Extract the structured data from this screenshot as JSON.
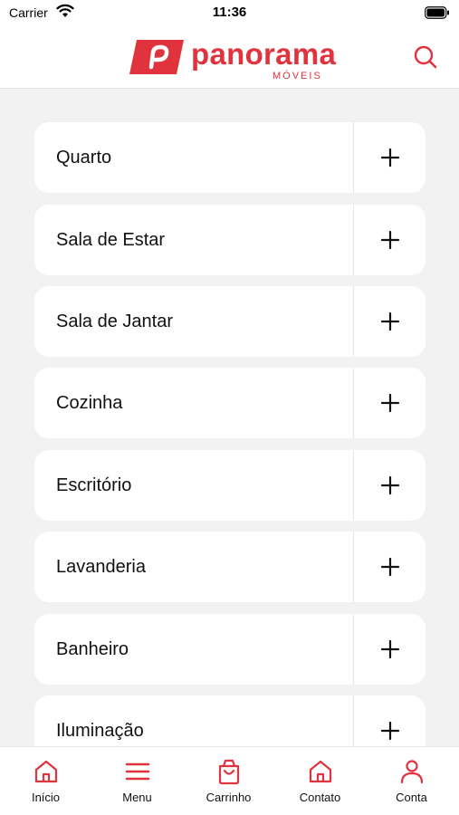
{
  "status_bar": {
    "carrier": "Carrier",
    "time": "11:36"
  },
  "header": {
    "logo_text": "panorama",
    "logo_sub": "MÓVEIS",
    "brand_color": "#e0333d",
    "search_icon": "search-icon"
  },
  "categories": [
    {
      "label": "Quarto"
    },
    {
      "label": "Sala de Estar"
    },
    {
      "label": "Sala de Jantar"
    },
    {
      "label": "Cozinha"
    },
    {
      "label": "Escritório"
    },
    {
      "label": "Lavanderia"
    },
    {
      "label": "Banheiro"
    },
    {
      "label": "Iluminação"
    }
  ],
  "bottom_nav": [
    {
      "label": "Início",
      "icon": "home-icon"
    },
    {
      "label": "Menu",
      "icon": "menu-icon"
    },
    {
      "label": "Carrinho",
      "icon": "bag-icon"
    },
    {
      "label": "Contato",
      "icon": "home-icon"
    },
    {
      "label": "Conta",
      "icon": "user-icon"
    }
  ]
}
